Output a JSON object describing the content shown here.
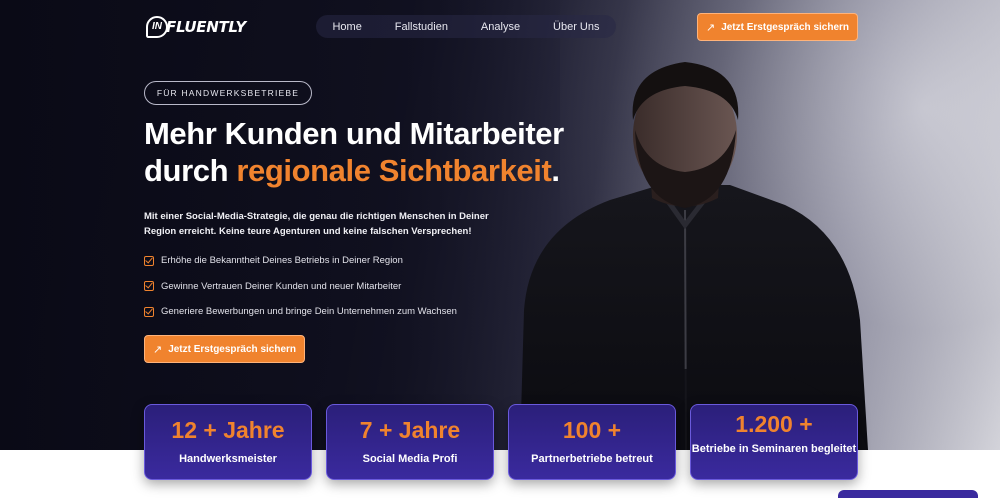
{
  "brand": {
    "logo_text": "INFLUENTLY",
    "logo_badge": "IN"
  },
  "nav": {
    "items": [
      "Home",
      "Fallstudien",
      "Analyse",
      "Über Uns"
    ]
  },
  "header_cta": {
    "label": "Jetzt Erstgespräch sichern",
    "icon": "arrow-up-right-icon"
  },
  "hero": {
    "badge": "FÜR HANDWERKSBETRIEBE",
    "headline_line1": "Mehr Kunden und Mitarbeiter",
    "headline_line2_prefix": "durch ",
    "headline_accent": "regionale Sichtbarkeit",
    "headline_suffix": ".",
    "lead": "Mit einer Social-Media-Strategie, die genau die richtigen Menschen in Deiner Region erreicht. Keine teure Agenturen und keine falschen Versprechen!",
    "checklist": [
      "Erhöhe die Bekanntheit Deines Betriebs in Deiner Region",
      "Gewinne Vertrauen Deiner Kunden und neuer Mitarbeiter",
      "Generiere Bewerbungen und bringe Dein Unternehmen zum Wachsen"
    ],
    "cta_label": "Jetzt Erstgespräch sichern"
  },
  "stats": [
    {
      "value": "12 + Jahre",
      "label": "Handwerksmeister"
    },
    {
      "value": "7 + Jahre",
      "label": "Social Media Profi"
    },
    {
      "value": "100 +",
      "label": "Partnerbetriebe betreut"
    },
    {
      "value": "1.200 +",
      "label": "Betriebe in Seminaren begleitet"
    }
  ],
  "colors": {
    "accent": "#f0832e",
    "stat_bg": "#2b1f7a",
    "hero_dark": "#0d0d1a"
  }
}
